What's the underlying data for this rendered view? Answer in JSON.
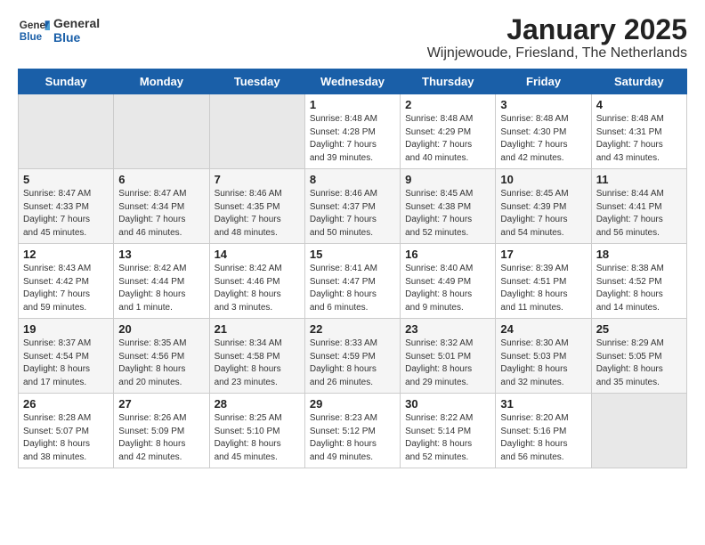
{
  "logo": {
    "general": "General",
    "blue": "Blue"
  },
  "title": "January 2025",
  "subtitle": "Wijnjewoude, Friesland, The Netherlands",
  "days_of_week": [
    "Sunday",
    "Monday",
    "Tuesday",
    "Wednesday",
    "Thursday",
    "Friday",
    "Saturday"
  ],
  "weeks": [
    [
      {
        "day": "",
        "info": ""
      },
      {
        "day": "",
        "info": ""
      },
      {
        "day": "",
        "info": ""
      },
      {
        "day": "1",
        "info": "Sunrise: 8:48 AM\nSunset: 4:28 PM\nDaylight: 7 hours\nand 39 minutes."
      },
      {
        "day": "2",
        "info": "Sunrise: 8:48 AM\nSunset: 4:29 PM\nDaylight: 7 hours\nand 40 minutes."
      },
      {
        "day": "3",
        "info": "Sunrise: 8:48 AM\nSunset: 4:30 PM\nDaylight: 7 hours\nand 42 minutes."
      },
      {
        "day": "4",
        "info": "Sunrise: 8:48 AM\nSunset: 4:31 PM\nDaylight: 7 hours\nand 43 minutes."
      }
    ],
    [
      {
        "day": "5",
        "info": "Sunrise: 8:47 AM\nSunset: 4:33 PM\nDaylight: 7 hours\nand 45 minutes."
      },
      {
        "day": "6",
        "info": "Sunrise: 8:47 AM\nSunset: 4:34 PM\nDaylight: 7 hours\nand 46 minutes."
      },
      {
        "day": "7",
        "info": "Sunrise: 8:46 AM\nSunset: 4:35 PM\nDaylight: 7 hours\nand 48 minutes."
      },
      {
        "day": "8",
        "info": "Sunrise: 8:46 AM\nSunset: 4:37 PM\nDaylight: 7 hours\nand 50 minutes."
      },
      {
        "day": "9",
        "info": "Sunrise: 8:45 AM\nSunset: 4:38 PM\nDaylight: 7 hours\nand 52 minutes."
      },
      {
        "day": "10",
        "info": "Sunrise: 8:45 AM\nSunset: 4:39 PM\nDaylight: 7 hours\nand 54 minutes."
      },
      {
        "day": "11",
        "info": "Sunrise: 8:44 AM\nSunset: 4:41 PM\nDaylight: 7 hours\nand 56 minutes."
      }
    ],
    [
      {
        "day": "12",
        "info": "Sunrise: 8:43 AM\nSunset: 4:42 PM\nDaylight: 7 hours\nand 59 minutes."
      },
      {
        "day": "13",
        "info": "Sunrise: 8:42 AM\nSunset: 4:44 PM\nDaylight: 8 hours\nand 1 minute."
      },
      {
        "day": "14",
        "info": "Sunrise: 8:42 AM\nSunset: 4:46 PM\nDaylight: 8 hours\nand 3 minutes."
      },
      {
        "day": "15",
        "info": "Sunrise: 8:41 AM\nSunset: 4:47 PM\nDaylight: 8 hours\nand 6 minutes."
      },
      {
        "day": "16",
        "info": "Sunrise: 8:40 AM\nSunset: 4:49 PM\nDaylight: 8 hours\nand 9 minutes."
      },
      {
        "day": "17",
        "info": "Sunrise: 8:39 AM\nSunset: 4:51 PM\nDaylight: 8 hours\nand 11 minutes."
      },
      {
        "day": "18",
        "info": "Sunrise: 8:38 AM\nSunset: 4:52 PM\nDaylight: 8 hours\nand 14 minutes."
      }
    ],
    [
      {
        "day": "19",
        "info": "Sunrise: 8:37 AM\nSunset: 4:54 PM\nDaylight: 8 hours\nand 17 minutes."
      },
      {
        "day": "20",
        "info": "Sunrise: 8:35 AM\nSunset: 4:56 PM\nDaylight: 8 hours\nand 20 minutes."
      },
      {
        "day": "21",
        "info": "Sunrise: 8:34 AM\nSunset: 4:58 PM\nDaylight: 8 hours\nand 23 minutes."
      },
      {
        "day": "22",
        "info": "Sunrise: 8:33 AM\nSunset: 4:59 PM\nDaylight: 8 hours\nand 26 minutes."
      },
      {
        "day": "23",
        "info": "Sunrise: 8:32 AM\nSunset: 5:01 PM\nDaylight: 8 hours\nand 29 minutes."
      },
      {
        "day": "24",
        "info": "Sunrise: 8:30 AM\nSunset: 5:03 PM\nDaylight: 8 hours\nand 32 minutes."
      },
      {
        "day": "25",
        "info": "Sunrise: 8:29 AM\nSunset: 5:05 PM\nDaylight: 8 hours\nand 35 minutes."
      }
    ],
    [
      {
        "day": "26",
        "info": "Sunrise: 8:28 AM\nSunset: 5:07 PM\nDaylight: 8 hours\nand 38 minutes."
      },
      {
        "day": "27",
        "info": "Sunrise: 8:26 AM\nSunset: 5:09 PM\nDaylight: 8 hours\nand 42 minutes."
      },
      {
        "day": "28",
        "info": "Sunrise: 8:25 AM\nSunset: 5:10 PM\nDaylight: 8 hours\nand 45 minutes."
      },
      {
        "day": "29",
        "info": "Sunrise: 8:23 AM\nSunset: 5:12 PM\nDaylight: 8 hours\nand 49 minutes."
      },
      {
        "day": "30",
        "info": "Sunrise: 8:22 AM\nSunset: 5:14 PM\nDaylight: 8 hours\nand 52 minutes."
      },
      {
        "day": "31",
        "info": "Sunrise: 8:20 AM\nSunset: 5:16 PM\nDaylight: 8 hours\nand 56 minutes."
      },
      {
        "day": "",
        "info": ""
      }
    ]
  ]
}
